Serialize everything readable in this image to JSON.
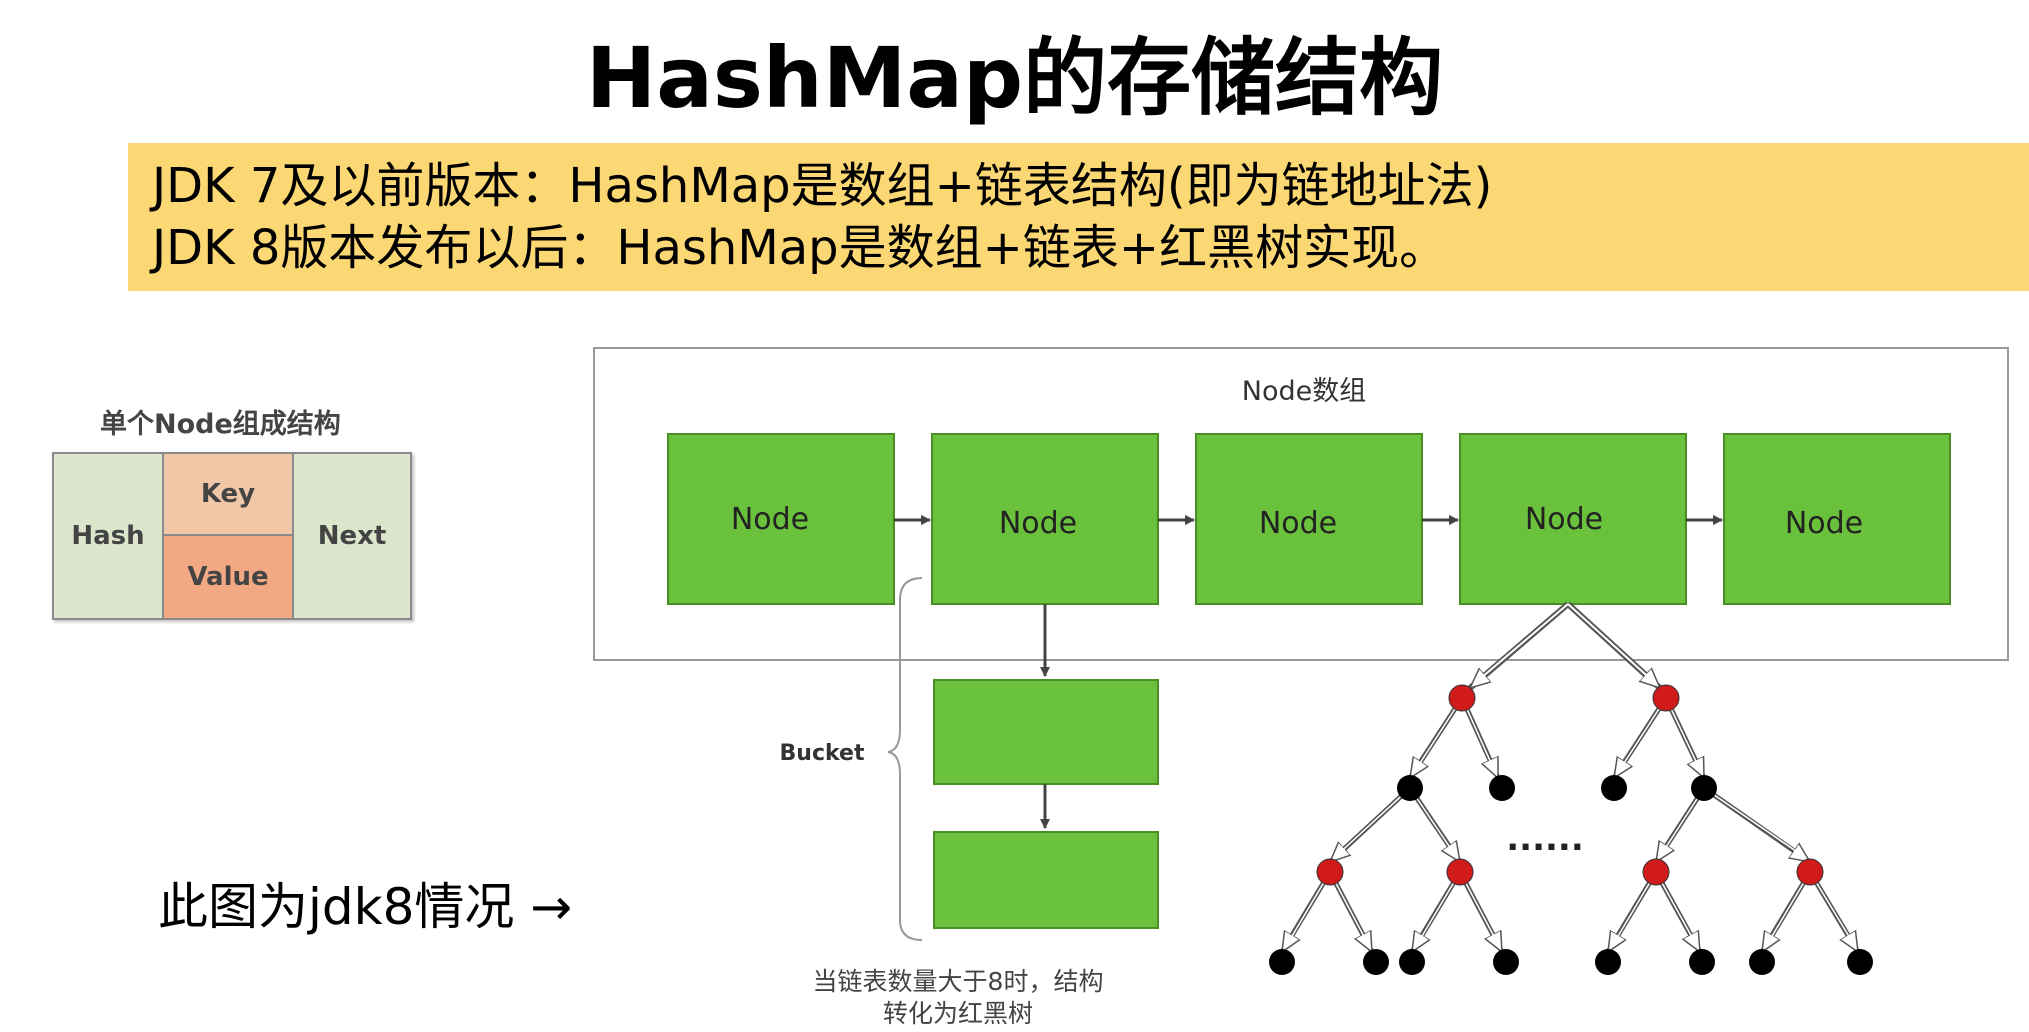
{
  "title": "HashMap的存储结构",
  "banner": {
    "line1": "JDK 7及以前版本：HashMap是数组+链表结构(即为链地址法)",
    "line2": "JDK 8版本发布以后：HashMap是数组+链表+红黑树实现。"
  },
  "node_structure": {
    "title": "单个Node组成结构",
    "hash": "Hash",
    "key": "Key",
    "value": "Value",
    "next": "Next"
  },
  "array": {
    "label": "Node数组",
    "nodes": [
      "Node",
      "Node",
      "Node",
      "Node",
      "Node"
    ]
  },
  "bucket_label": "Bucket",
  "ellipsis": "......",
  "caption_line1": "当链表数量大于8时，结构",
  "caption_line2": "转化为红黑树",
  "note": "此图为jdk8情况 →",
  "colors": {
    "banner": "#fcd874",
    "node_green": "#6ac13b",
    "red_node": "#d11a1a",
    "black_node": "#000000"
  }
}
